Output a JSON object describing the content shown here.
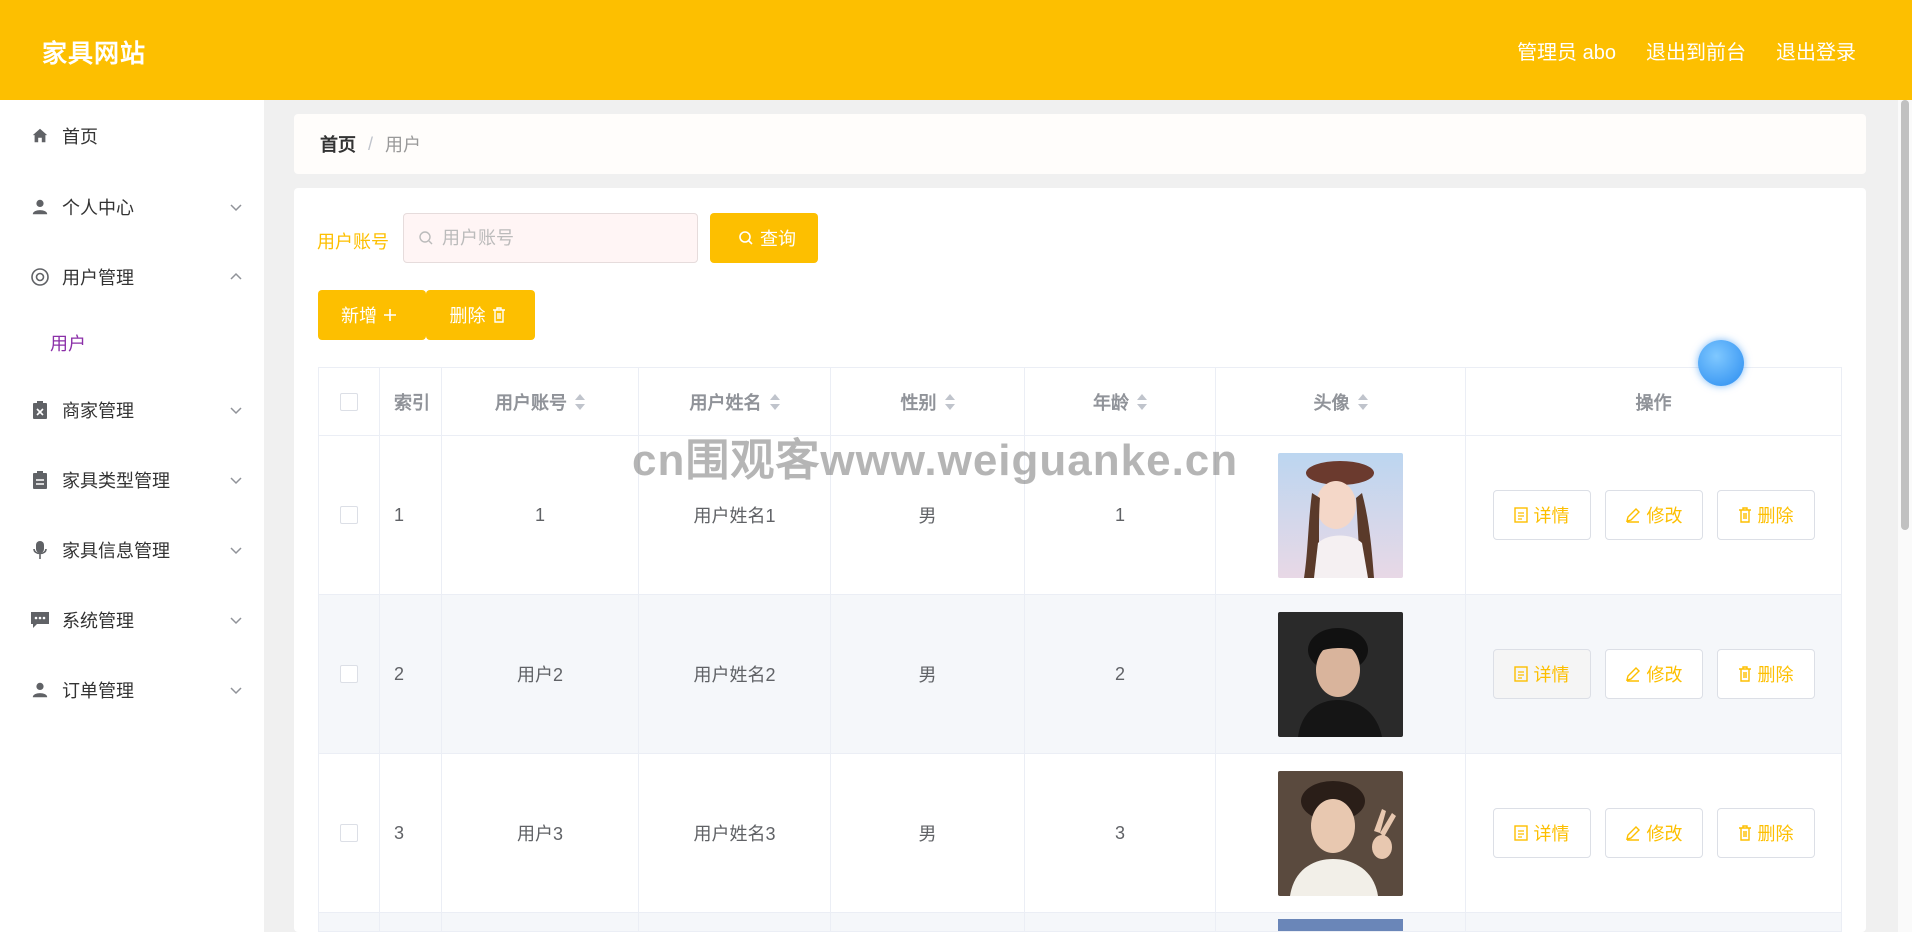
{
  "header": {
    "brand": "家具网站",
    "links": [
      "管理员 abo",
      "退出到前台",
      "退出登录"
    ]
  },
  "sidebar": {
    "items": [
      {
        "label": "首页",
        "icon": "home-icon"
      },
      {
        "label": "个人中心",
        "icon": "user-icon"
      },
      {
        "label": "用户管理",
        "icon": "lifebuoy-icon"
      },
      {
        "label": "商家管理",
        "icon": "clipboard-x-icon"
      },
      {
        "label": "家具类型管理",
        "icon": "clipboard-icon"
      },
      {
        "label": "家具信息管理",
        "icon": "microphone-icon"
      },
      {
        "label": "系统管理",
        "icon": "chat-icon"
      },
      {
        "label": "订单管理",
        "icon": "user-icon"
      }
    ],
    "sub_item": "用户"
  },
  "breadcrumb": {
    "home": "首页",
    "sep": "/",
    "current": "用户"
  },
  "search": {
    "label": "用户账号",
    "placeholder": "用户账号",
    "button": "查询"
  },
  "toolbar": {
    "add": "新增",
    "delete": "删除"
  },
  "table": {
    "headers": [
      "索引",
      "用户账号",
      "用户姓名",
      "性别",
      "年龄",
      "头像",
      "操作"
    ],
    "rows": [
      {
        "index": "1",
        "account": "1",
        "name": "用户姓名1",
        "sex": "男",
        "age": "1"
      },
      {
        "index": "2",
        "account": "用户2",
        "name": "用户姓名2",
        "sex": "男",
        "age": "2"
      },
      {
        "index": "3",
        "account": "用户3",
        "name": "用户姓名3",
        "sex": "男",
        "age": "3"
      }
    ],
    "ops": {
      "detail": "详情",
      "edit": "修改",
      "delete": "删除"
    }
  },
  "watermark": "cn围观客www.weiguanke.cn",
  "colors": {
    "accent": "#fdbf00",
    "submenu_active": "#8b2fa8"
  }
}
